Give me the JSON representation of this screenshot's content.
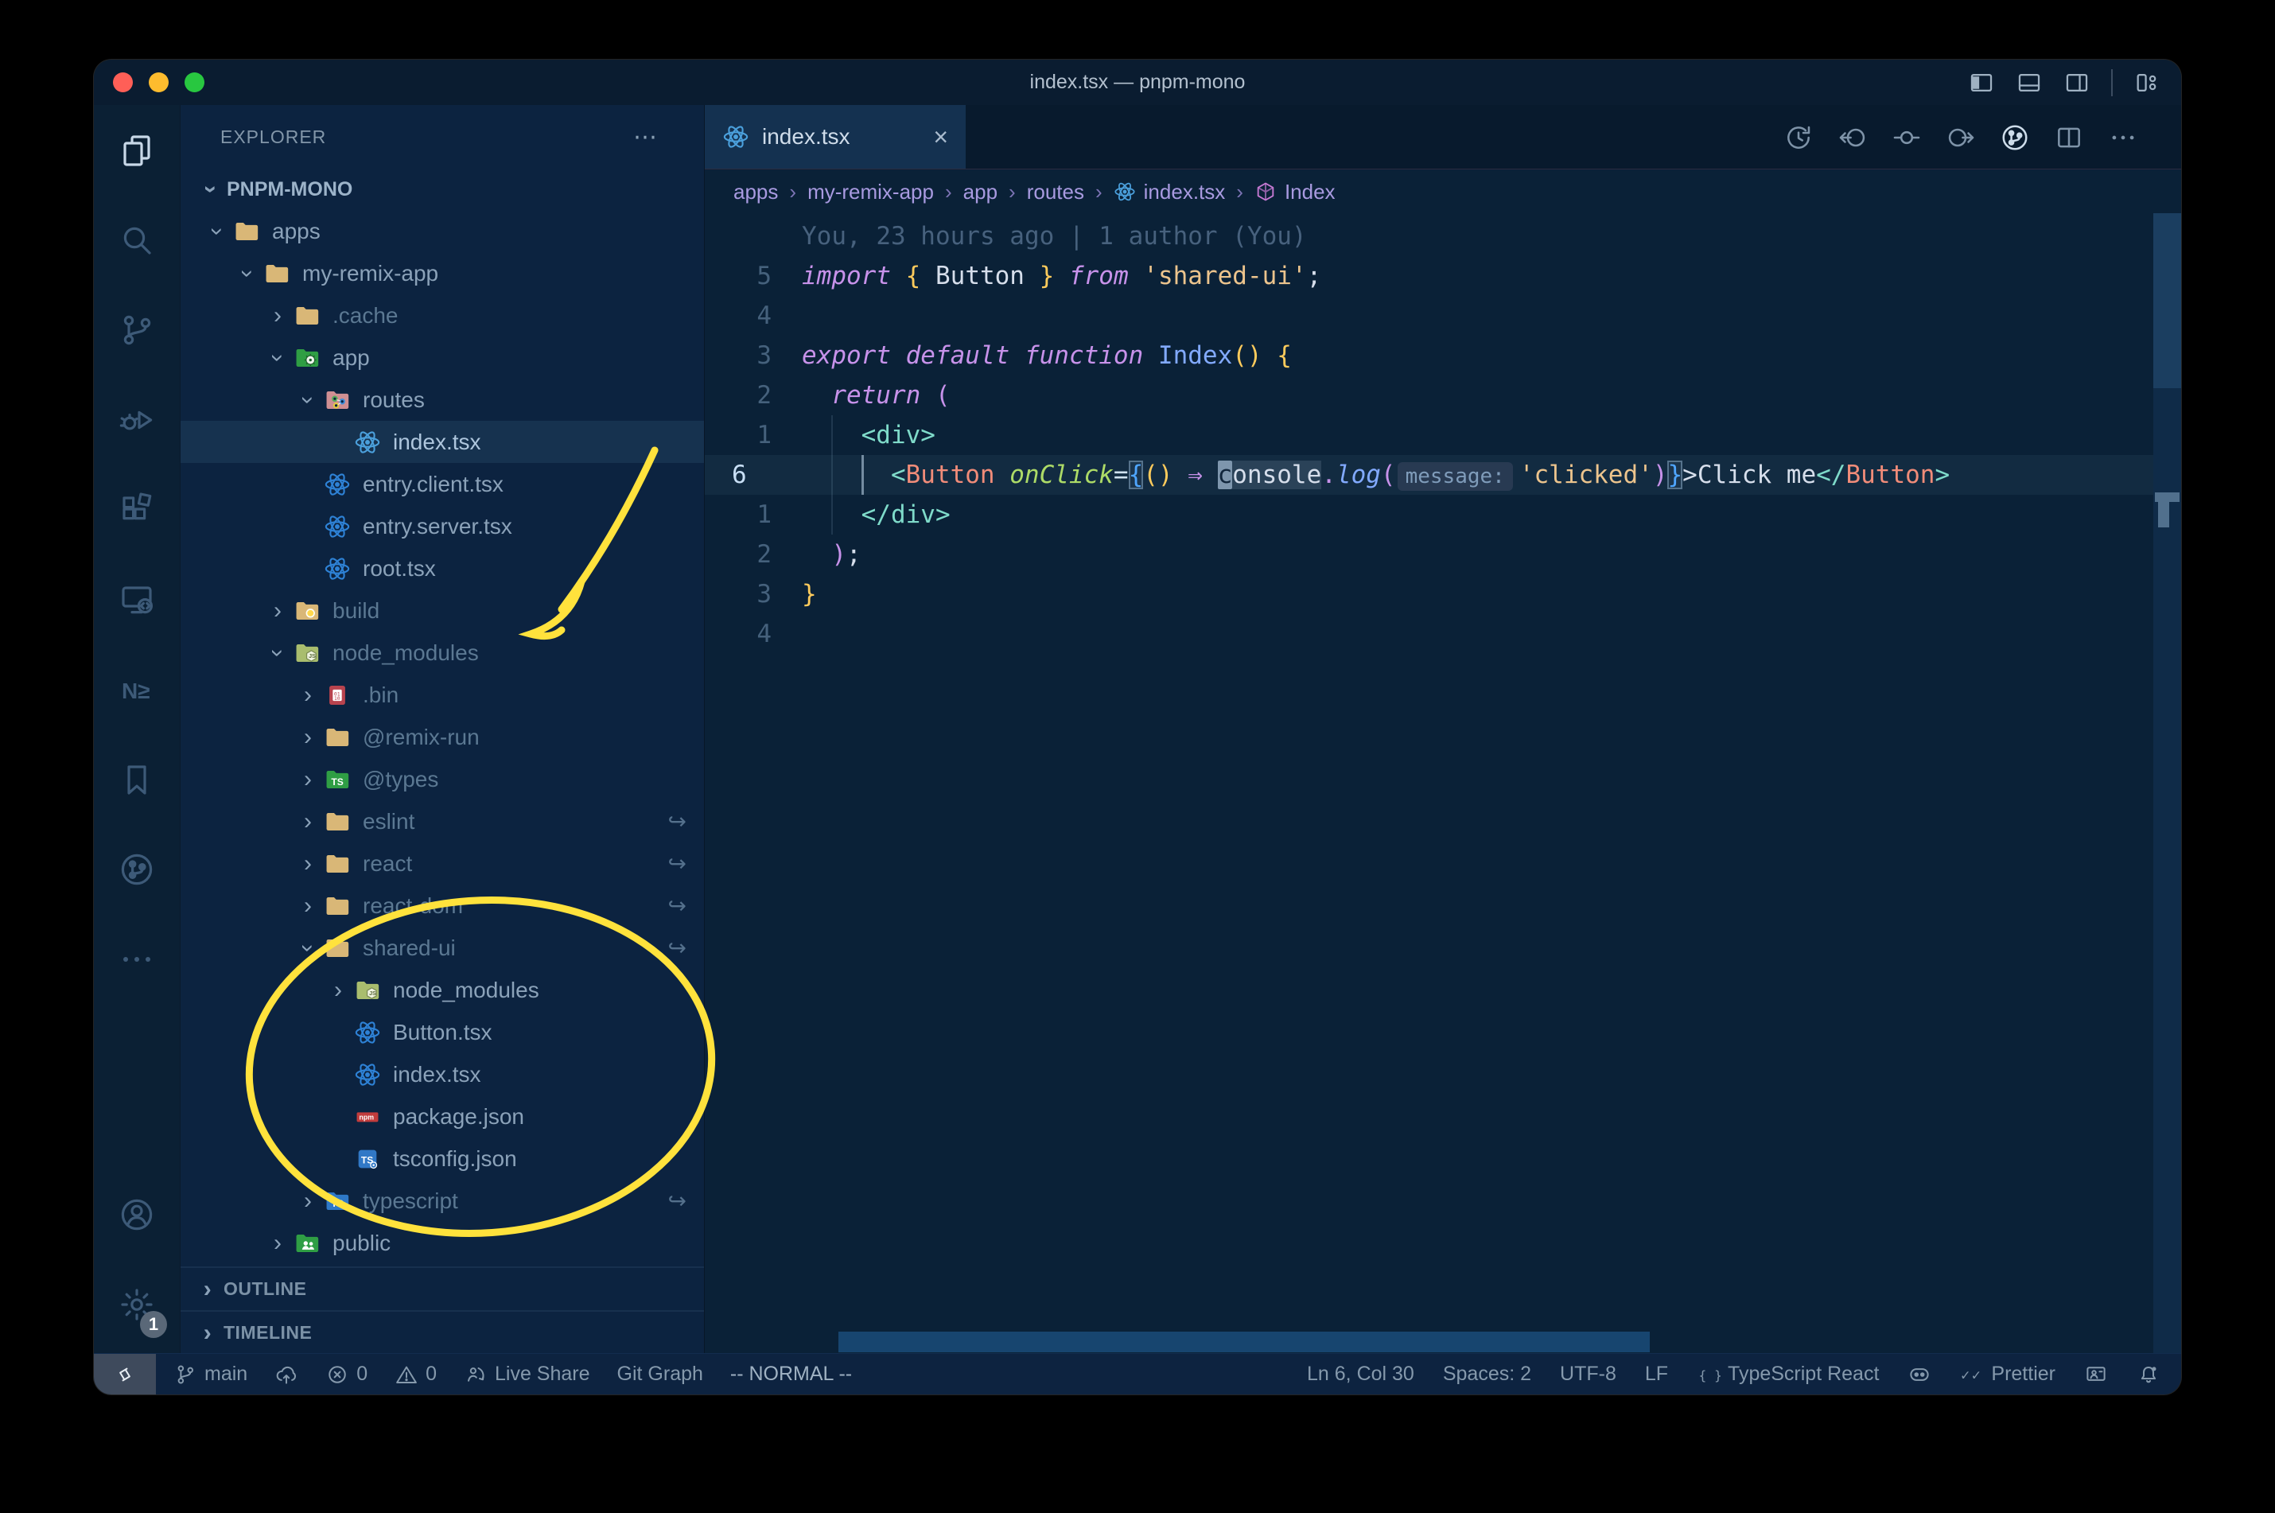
{
  "window": {
    "title": "index.tsx — pnpm-mono",
    "traffic_lights": {
      "close": "#ff5f57",
      "minimize": "#febc2e",
      "zoom": "#28c740"
    }
  },
  "title_bar_icons": [
    "toggle-primary-sidebar",
    "toggle-panel",
    "toggle-secondary-sidebar",
    "customize-layout"
  ],
  "activity_bar": {
    "top": [
      {
        "icon": "files",
        "active": true
      },
      {
        "icon": "search"
      },
      {
        "icon": "source-control"
      },
      {
        "icon": "run-debug"
      },
      {
        "icon": "extensions"
      },
      {
        "icon": "remote-explorer"
      },
      {
        "icon": "nx-console"
      },
      {
        "icon": "bookmarks"
      },
      {
        "icon": "git-graph"
      },
      {
        "icon": "more"
      }
    ],
    "bottom": [
      {
        "icon": "accounts"
      },
      {
        "icon": "settings",
        "badge": "1"
      }
    ],
    "nx_glyph": "N≥"
  },
  "explorer": {
    "header": "EXPLORER",
    "more_label": "⋯",
    "workspace": "PNPM-MONO",
    "sections": [
      "OUTLINE",
      "TIMELINE"
    ],
    "tree": [
      {
        "label": "apps",
        "depth": 0,
        "chev": "down",
        "icon": "folder"
      },
      {
        "label": "my-remix-app",
        "depth": 1,
        "chev": "down",
        "icon": "folder"
      },
      {
        "label": ".cache",
        "depth": 2,
        "chev": "right",
        "icon": "folder",
        "dim": true
      },
      {
        "label": "app",
        "depth": 2,
        "chev": "down",
        "icon": "folder-app"
      },
      {
        "label": "routes",
        "depth": 3,
        "chev": "down",
        "icon": "folder-routes"
      },
      {
        "label": "index.tsx",
        "depth": 4,
        "icon": "react",
        "selected": true
      },
      {
        "label": "entry.client.tsx",
        "depth": 3,
        "icon": "react"
      },
      {
        "label": "entry.server.tsx",
        "depth": 3,
        "icon": "react"
      },
      {
        "label": "root.tsx",
        "depth": 3,
        "icon": "react"
      },
      {
        "label": "build",
        "depth": 2,
        "chev": "right",
        "icon": "folder-build",
        "dim": true
      },
      {
        "label": "node_modules",
        "depth": 2,
        "chev": "down",
        "icon": "folder-nm",
        "dim": true
      },
      {
        "label": ".bin",
        "depth": 3,
        "chev": "right",
        "icon": "bin",
        "dim": true
      },
      {
        "label": "@remix-run",
        "depth": 3,
        "chev": "right",
        "icon": "folder",
        "dim": true
      },
      {
        "label": "@types",
        "depth": 3,
        "chev": "right",
        "icon": "folder-ts-green",
        "dim": true
      },
      {
        "label": "eslint",
        "depth": 3,
        "chev": "right",
        "icon": "folder",
        "dim": true,
        "symlink": true
      },
      {
        "label": "react",
        "depth": 3,
        "chev": "right",
        "icon": "folder",
        "dim": true,
        "symlink": true
      },
      {
        "label": "react-dom",
        "depth": 3,
        "chev": "right",
        "icon": "folder",
        "dim": true,
        "symlink": true
      },
      {
        "label": "shared-ui",
        "depth": 3,
        "chev": "down",
        "icon": "folder",
        "dim": true,
        "symlink": true
      },
      {
        "label": "node_modules",
        "depth": 4,
        "chev": "right",
        "icon": "folder-nm"
      },
      {
        "label": "Button.tsx",
        "depth": 4,
        "icon": "react"
      },
      {
        "label": "index.tsx",
        "depth": 4,
        "icon": "react"
      },
      {
        "label": "package.json",
        "depth": 4,
        "icon": "npm"
      },
      {
        "label": "tsconfig.json",
        "depth": 4,
        "icon": "tsconfig"
      },
      {
        "label": "typescript",
        "depth": 3,
        "chev": "right",
        "icon": "folder-ts-blue",
        "dim": true,
        "symlink": true
      },
      {
        "label": "public",
        "depth": 2,
        "chev": "right",
        "icon": "folder-public"
      }
    ],
    "symlink_glyph": "↪"
  },
  "tab": {
    "label": "index.tsx",
    "icon": "react",
    "close_glyph": "×"
  },
  "breadcrumbs": [
    {
      "label": "apps"
    },
    {
      "label": "my-remix-app"
    },
    {
      "label": "app"
    },
    {
      "label": "routes"
    },
    {
      "label": "index.tsx",
      "icon": "react"
    },
    {
      "label": "Index",
      "icon": "symbol-module"
    }
  ],
  "editor_actions": [
    {
      "icon": "history"
    },
    {
      "icon": "change-prev"
    },
    {
      "icon": "commit"
    },
    {
      "icon": "change-next"
    },
    {
      "icon": "gitlens-graph",
      "bright": true
    },
    {
      "icon": "split-editor"
    },
    {
      "icon": "more-actions"
    }
  ],
  "editor": {
    "blame": "You, 23 hours ago | 1 author (You)",
    "lines": [
      {
        "num": "",
        "blame": true
      },
      {
        "num": "5",
        "tokens": [
          [
            "kw",
            "import"
          ],
          [
            "tx",
            " "
          ],
          [
            "gold",
            "{"
          ],
          [
            "tx",
            " Button "
          ],
          [
            "gold",
            "}"
          ],
          [
            "kw",
            " from"
          ],
          [
            "str",
            " 'shared-ui'"
          ],
          [
            "tx",
            ";"
          ]
        ]
      },
      {
        "num": "4",
        "tokens": []
      },
      {
        "num": "3",
        "tokens": [
          [
            "kw",
            "export default function"
          ],
          [
            "blue",
            " Index"
          ],
          [
            "gold",
            "()"
          ],
          [
            "tx",
            " "
          ],
          [
            "gold",
            "{"
          ]
        ]
      },
      {
        "num": "2",
        "tokens": [
          [
            "sp",
            ""
          ],
          [
            "kw",
            "return"
          ],
          [
            "tx",
            " "
          ],
          [
            "mag",
            "("
          ]
        ]
      },
      {
        "num": "1",
        "tokens": [
          [
            "sp",
            ""
          ],
          [
            "gf",
            ""
          ],
          [
            "tag",
            "<div>"
          ]
        ]
      },
      {
        "num": "6",
        "current": true,
        "tokens": [
          [
            "sp",
            ""
          ],
          [
            "gf",
            ""
          ],
          [
            "gb",
            ""
          ],
          [
            "tag",
            "<"
          ],
          [
            "comp",
            "Button"
          ],
          [
            "attr",
            " onClick"
          ],
          [
            "op",
            "="
          ],
          [
            "jbr",
            "{"
          ],
          [
            "gold",
            "()"
          ],
          [
            "tx",
            " "
          ],
          [
            "mag",
            "⇒"
          ],
          [
            "tx",
            " "
          ],
          [
            "cur",
            "c"
          ],
          [
            "occ",
            "onsole"
          ],
          [
            "mag",
            "."
          ],
          [
            "fnb",
            "log"
          ],
          [
            "mag",
            "("
          ],
          [
            "inlay",
            "message:"
          ],
          [
            "str",
            "'clicked'"
          ],
          [
            "mag",
            ")"
          ],
          [
            "jbr",
            "}"
          ],
          [
            "tx",
            ">Click me"
          ],
          [
            "tag",
            "</"
          ],
          [
            "comp",
            "Button"
          ],
          [
            "tag",
            ">"
          ]
        ]
      },
      {
        "num": "1",
        "tokens": [
          [
            "sp",
            ""
          ],
          [
            "gf",
            ""
          ],
          [
            "tag",
            "</div>"
          ]
        ]
      },
      {
        "num": "2",
        "tokens": [
          [
            "sp",
            ""
          ],
          [
            "mag",
            ")"
          ],
          [
            "tx",
            ";"
          ]
        ]
      },
      {
        "num": "3",
        "tokens": [
          [
            "gold",
            "}"
          ]
        ]
      },
      {
        "num": "4",
        "tokens": []
      }
    ]
  },
  "status_bar": {
    "left": [
      {
        "icon": "git-branch",
        "label": "main",
        "name": "branch"
      },
      {
        "icon": "cloud-upload",
        "name": "publish"
      },
      {
        "icon": "error-circle",
        "label": "0",
        "name": "errors"
      },
      {
        "icon": "warning-triangle",
        "label": "0",
        "name": "warnings"
      },
      {
        "icon": "live-share",
        "label": "Live Share",
        "name": "live-share"
      },
      {
        "label": "Git Graph",
        "name": "git-graph"
      },
      {
        "label": "-- NORMAL --",
        "name": "vim-mode",
        "vim": true
      }
    ],
    "right": [
      {
        "label": "Ln 6, Col 30",
        "name": "cursor-position"
      },
      {
        "label": "Spaces: 2",
        "name": "indentation"
      },
      {
        "label": "UTF-8",
        "name": "encoding"
      },
      {
        "label": "LF",
        "name": "eol"
      },
      {
        "icon": "braces",
        "label": "TypeScript React",
        "name": "language-mode"
      },
      {
        "icon": "copilot",
        "name": "copilot"
      },
      {
        "icon": "double-check",
        "label": "Prettier",
        "name": "formatter"
      },
      {
        "icon": "feedback",
        "name": "feedback"
      },
      {
        "icon": "bell-dot",
        "name": "notifications"
      }
    ],
    "braces_glyph": "{ }",
    "checks_glyph": "✓✓",
    "remote_glyph": "><"
  },
  "annotations": {
    "color": "#ffe23c",
    "items": [
      "hand-drawn arrow pointing at node_modules",
      "hand-drawn ellipse around shared-ui package files"
    ]
  }
}
